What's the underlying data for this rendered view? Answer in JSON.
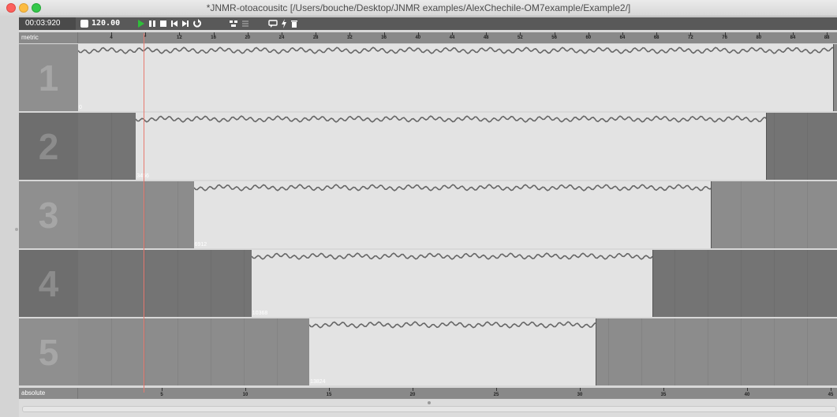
{
  "window": {
    "title": "*JNMR-otoacousitc  [/Users/bouche/Desktop/JNMR examples/AlexChechile-OM7example/Example2/]"
  },
  "toolbar": {
    "time": "00:03:920",
    "tempo": "120.00",
    "icons": [
      "play-icon",
      "pause-icon",
      "stop-icon",
      "previous-icon",
      "next-icon",
      "loop-icon",
      "tracks-icon",
      "list-icon",
      "speech-bubble-icon",
      "lightning-icon",
      "trash-icon"
    ]
  },
  "metric_ruler": {
    "label": "metric",
    "ticks": [
      "4",
      "*",
      "12",
      "16",
      "20",
      "24",
      "28",
      "32",
      "36",
      "40",
      "44",
      "48",
      "52",
      "56",
      "60",
      "64",
      "68",
      "72",
      "76",
      "80",
      "84",
      "88"
    ]
  },
  "absolute_ruler": {
    "label": "absolute",
    "ticks": [
      "5",
      "10",
      "15",
      "20",
      "25",
      "30",
      "35",
      "40",
      "45"
    ]
  },
  "tracks": [
    {
      "number": "1",
      "offset": "0",
      "start_s": 0,
      "end_s": 45.2,
      "region_color": "#e3e3e3",
      "lane_color": "#8a8a8a",
      "numbox_bg": "#8f8f8f",
      "numbox_fg": "#a6a6a6"
    },
    {
      "number": "2",
      "offset": "3456",
      "start_s": 3.456,
      "end_s": 41.2,
      "region_color": "#e3e3e3",
      "lane_color": "#747474",
      "numbox_bg": "#6e6e6e",
      "numbox_fg": "#8c8c8c"
    },
    {
      "number": "3",
      "offset": "6912",
      "start_s": 6.912,
      "end_s": 37.9,
      "region_color": "#e3e3e3",
      "lane_color": "#8c8c8c",
      "numbox_bg": "#8f8f8f",
      "numbox_fg": "#a6a6a6"
    },
    {
      "number": "4",
      "offset": "10368",
      "start_s": 10.368,
      "end_s": 34.4,
      "region_color": "#e3e3e3",
      "lane_color": "#747474",
      "numbox_bg": "#6e6e6e",
      "numbox_fg": "#8c8c8c"
    },
    {
      "number": "5",
      "offset": "13824",
      "start_s": 13.824,
      "end_s": 31.0,
      "region_color": "#e3e3e3",
      "lane_color": "#8c8c8c",
      "numbox_bg": "#8f8f8f",
      "numbox_fg": "#a6a6a6"
    }
  ],
  "playhead_time_s": 3.92,
  "colors": {
    "play": "#2fbf3a",
    "playhead": "#e87a70"
  }
}
